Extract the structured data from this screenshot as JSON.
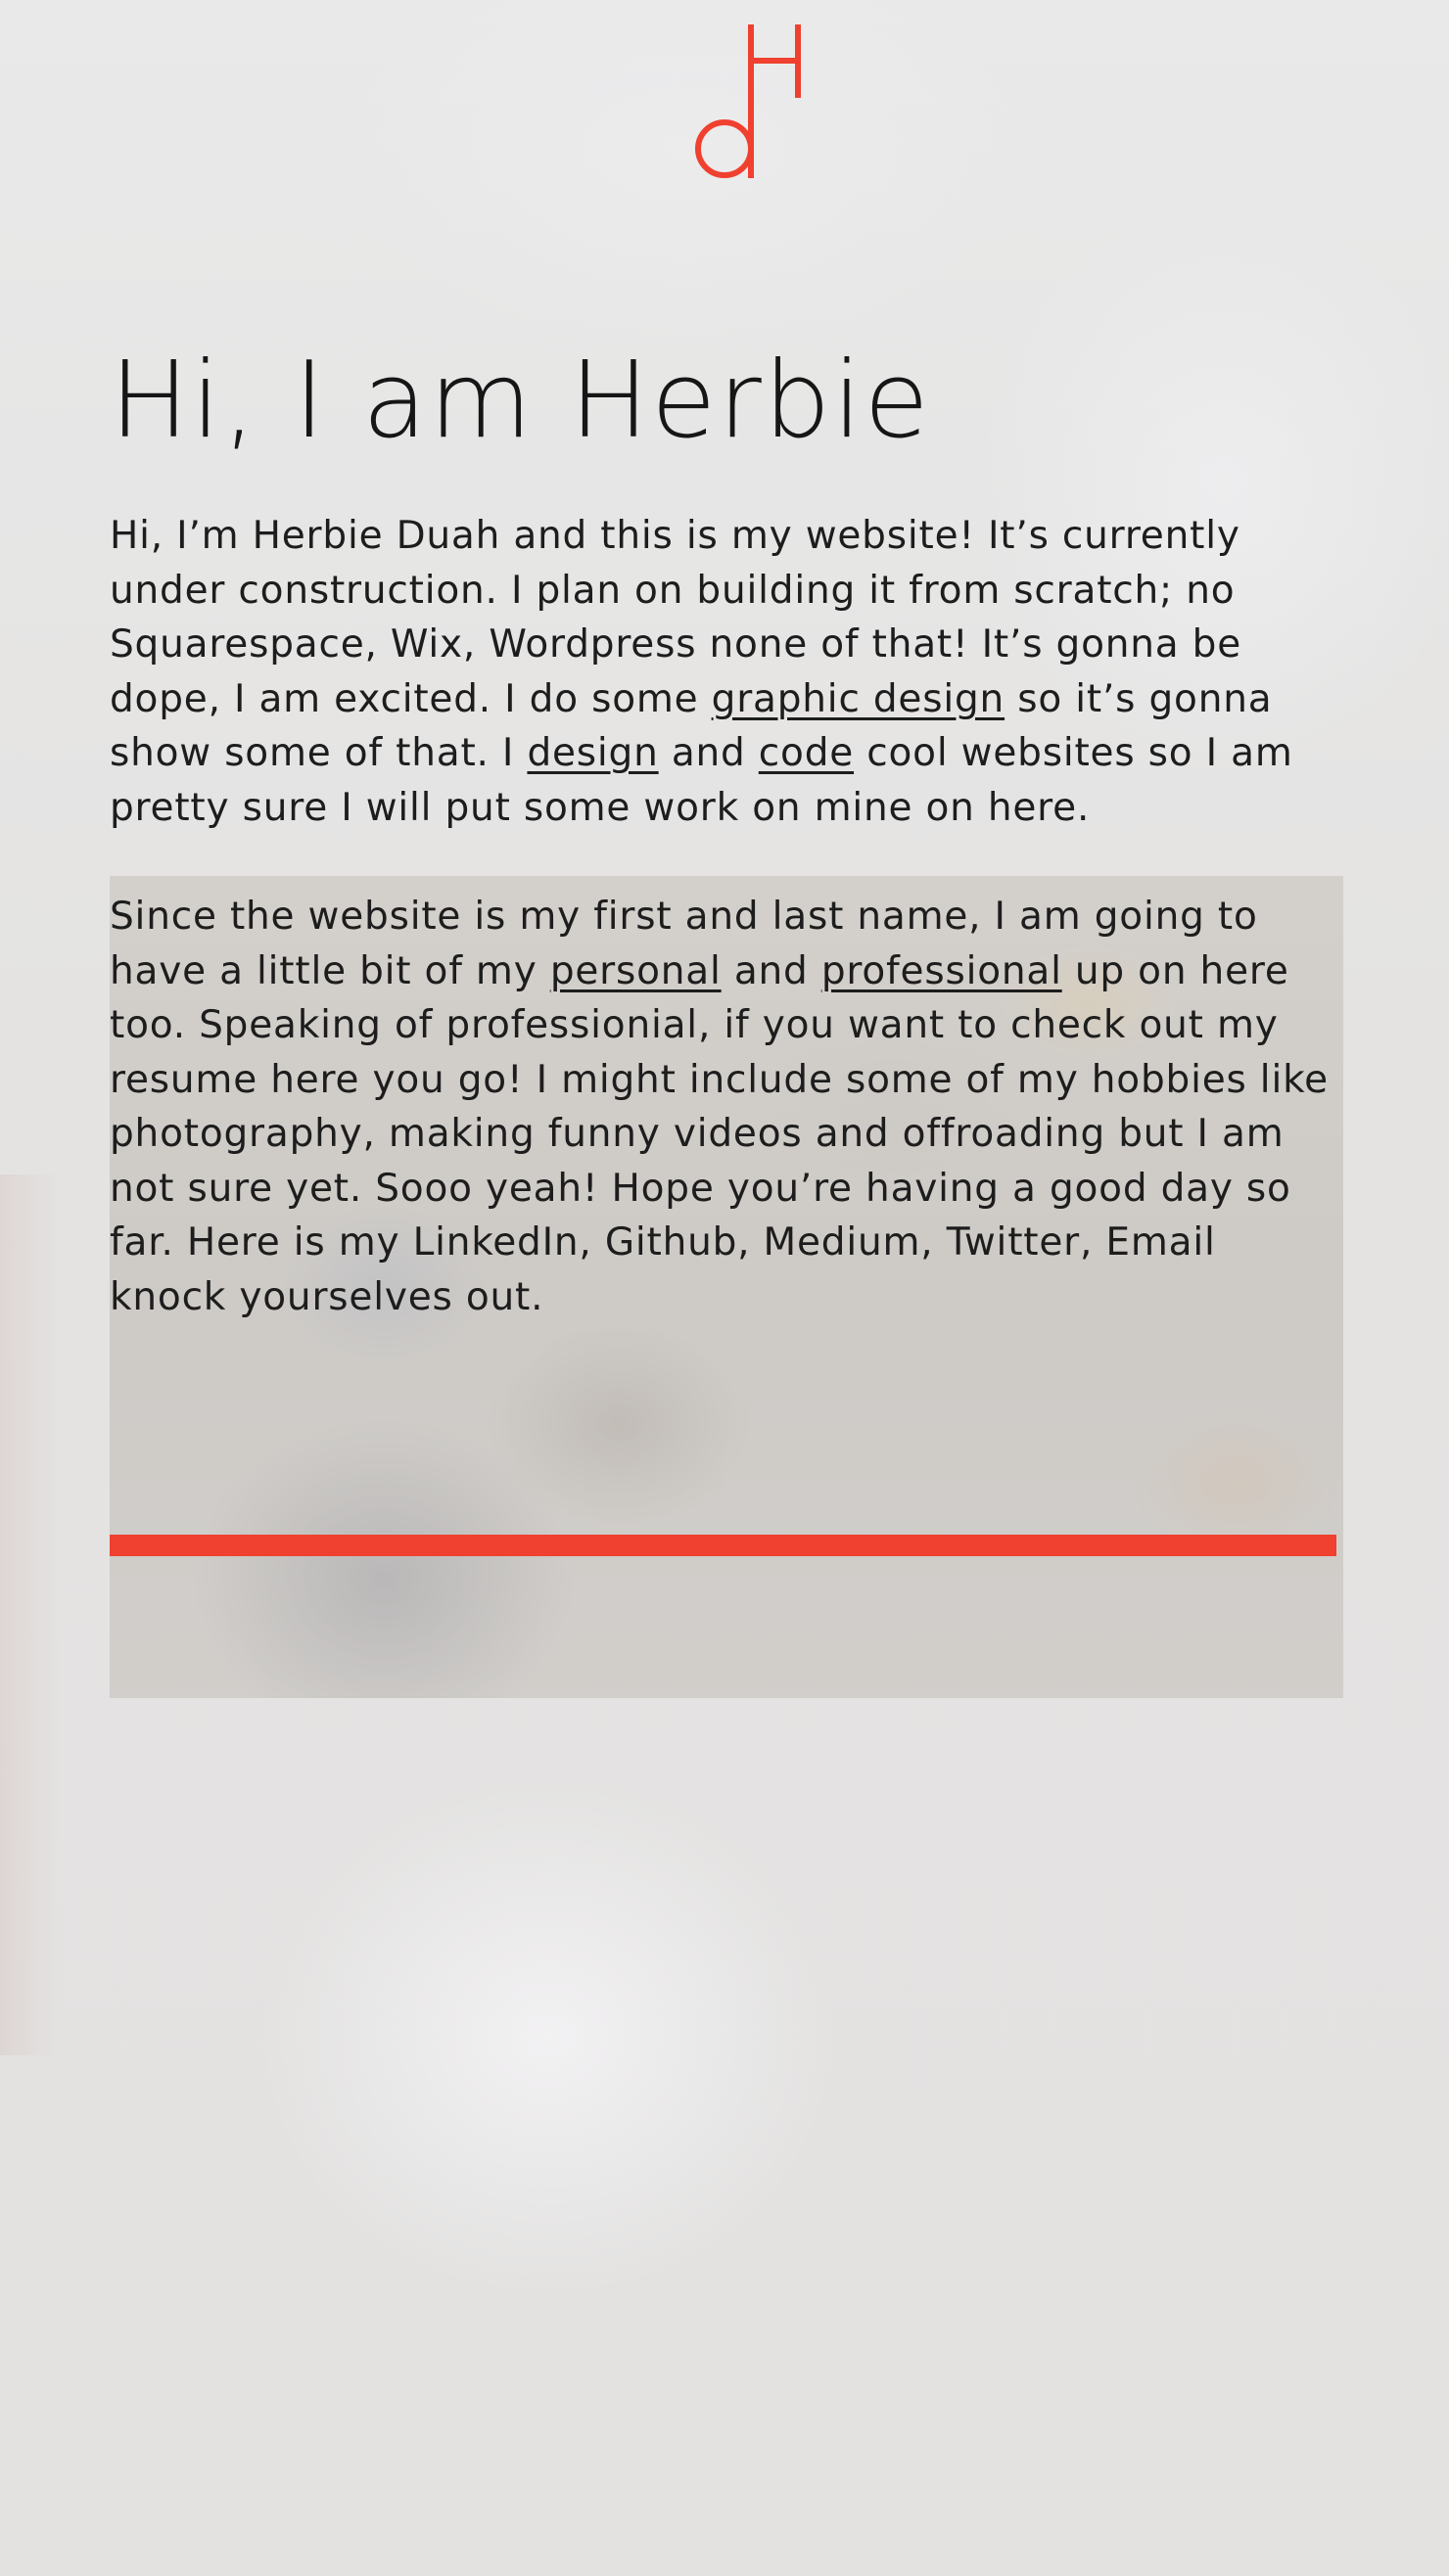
{
  "brand": {
    "logo_letters": "dH",
    "accent_color": "#f0402f"
  },
  "header": {
    "title": "Hi, I am Herbie"
  },
  "about": {
    "paragraph1": {
      "t1": "Hi, I’m Herbie Duah and this is my website! It’s currently under construction. I plan on building it from scratch; no Squarespace, Wix, Wordpress none of that! It’s gonna be dope, I am excited. I do some ",
      "link_graphic_design": "graphic design",
      "t2": " so it’s gonna show some of that. I ",
      "link_design": "design",
      "t3": " and ",
      "link_code": "code",
      "t4": " cool websites so I am pretty sure I will put some work on mine on here."
    },
    "paragraph2": {
      "t1": "Since the website is my first and last name, I am going to have a little bit of my ",
      "link_personal": "personal",
      "t2": " and ",
      "link_professional": "professional",
      "t3": " up on here too. Speaking of professionial, if you want to check out my resume here you go! I might include some of my hobbies like photography, making funny videos and offroading but I am not sure yet. Sooo yeah! Hope you’re having a good day so far. Here is my LinkedIn, Github, Medium, Twitter, Email knock yourselves out."
    }
  },
  "colors": {
    "background": "#e6e5e4",
    "text": "#1d1d1d",
    "divider": "#f0402f"
  }
}
